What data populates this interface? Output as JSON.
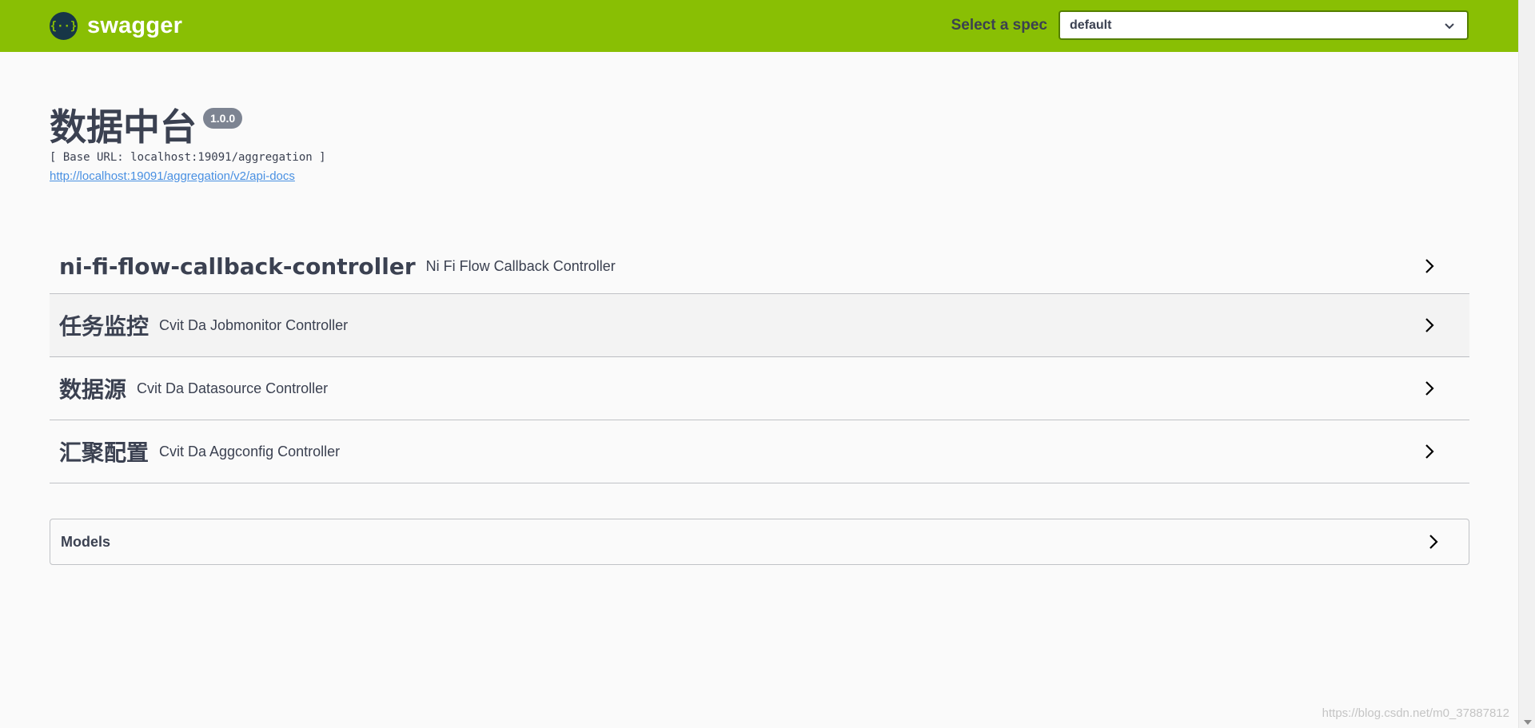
{
  "topbar": {
    "logo_mark": "{··}",
    "logo_text": "swagger",
    "spec_label": "Select a spec",
    "spec_selected": "default"
  },
  "info": {
    "title": "数据中台",
    "version": "1.0.0",
    "base_url": "[ Base URL: localhost:19091/aggregation ]",
    "api_docs_link": "http://localhost:19091/aggregation/v2/api-docs"
  },
  "tags": [
    {
      "name": "ni-fi-flow-callback-controller",
      "description": "Ni Fi Flow Callback Controller"
    },
    {
      "name": "任务监控",
      "description": "Cvit Da Jobmonitor Controller"
    },
    {
      "name": "数据源",
      "description": "Cvit Da Datasource Controller"
    },
    {
      "name": "汇聚配置",
      "description": "Cvit Da Aggconfig Controller"
    }
  ],
  "models": {
    "label": "Models"
  },
  "watermark": "https://blog.csdn.net/m0_37887812",
  "colors": {
    "topbar": "#89bf04",
    "text": "#3b4151",
    "version_badge": "#7d8492",
    "link": "#4990e2"
  },
  "icons": {
    "spec_dropdown": "chevron-down-icon",
    "tag_expand": "chevron-right-icon",
    "models_expand": "chevron-right-icon"
  }
}
